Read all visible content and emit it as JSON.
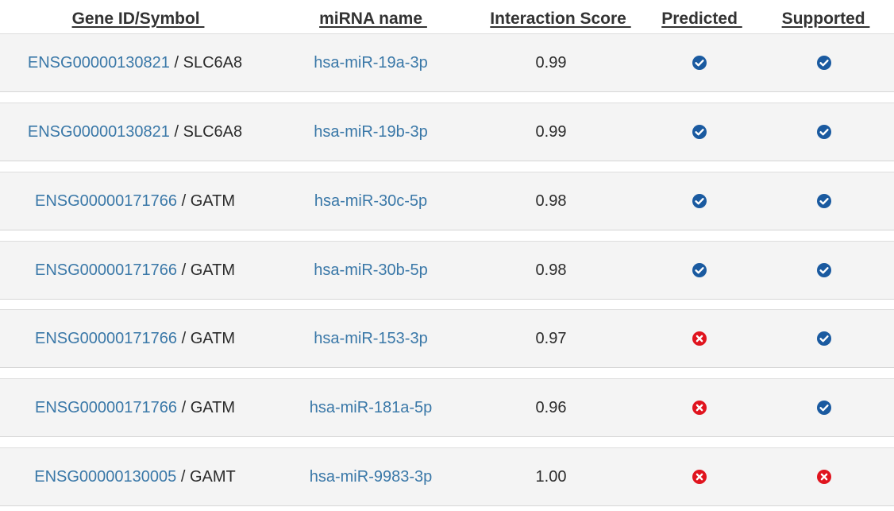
{
  "headers": {
    "gene": "Gene ID/Symbol ",
    "mirna": "miRNA name ",
    "score": "Interaction Score ",
    "predicted": "Predicted ",
    "supported": "Supported "
  },
  "separator": " / ",
  "colors": {
    "link": "#3a78a8",
    "check": "#1a5aa0",
    "cross": "#e0141e",
    "row_bg": "#f4f4f4"
  },
  "rows": [
    {
      "gene_id": "ENSG00000130821",
      "symbol": "SLC6A8",
      "mirna": "hsa-miR-19a-3p",
      "score": "0.99",
      "predicted": "check-icon",
      "supported": "check-icon"
    },
    {
      "gene_id": "ENSG00000130821",
      "symbol": "SLC6A8",
      "mirna": "hsa-miR-19b-3p",
      "score": "0.99",
      "predicted": "check-icon",
      "supported": "check-icon"
    },
    {
      "gene_id": "ENSG00000171766",
      "symbol": "GATM",
      "mirna": "hsa-miR-30c-5p",
      "score": "0.98",
      "predicted": "check-icon",
      "supported": "check-icon"
    },
    {
      "gene_id": "ENSG00000171766",
      "symbol": "GATM",
      "mirna": "hsa-miR-30b-5p",
      "score": "0.98",
      "predicted": "check-icon",
      "supported": "check-icon"
    },
    {
      "gene_id": "ENSG00000171766",
      "symbol": "GATM",
      "mirna": "hsa-miR-153-3p",
      "score": "0.97",
      "predicted": "cross-icon",
      "supported": "check-icon"
    },
    {
      "gene_id": "ENSG00000171766",
      "symbol": "GATM",
      "mirna": "hsa-miR-181a-5p",
      "score": "0.96",
      "predicted": "cross-icon",
      "supported": "check-icon"
    },
    {
      "gene_id": "ENSG00000130005",
      "symbol": "GAMT",
      "mirna": "hsa-miR-9983-3p",
      "score": "1.00",
      "predicted": "cross-icon",
      "supported": "cross-icon"
    }
  ]
}
